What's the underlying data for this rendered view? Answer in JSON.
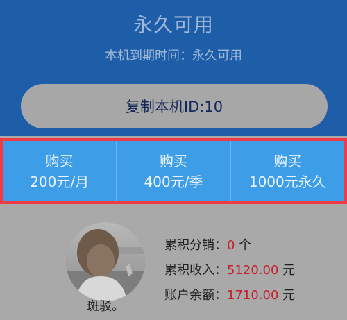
{
  "header": {
    "title": "永久可用",
    "expire_text": "本机到期时间：永久可用"
  },
  "copy_button": {
    "label": "复制本机ID:10"
  },
  "buy_options": [
    {
      "action": "购买",
      "price": "200元/月"
    },
    {
      "action": "购买",
      "price": "400元/季"
    },
    {
      "action": "购买",
      "price": "1000元永久"
    }
  ],
  "profile": {
    "username": "斑驳。"
  },
  "stats": [
    {
      "label": "累积分销：",
      "value": "0",
      "unit": " 个"
    },
    {
      "label": "累积收入：",
      "value": "5120.00",
      "unit": " 元"
    },
    {
      "label": "账户余额：",
      "value": "1710.00",
      "unit": " 元"
    }
  ],
  "colors": {
    "header_bg": "#1e5ea8",
    "body_bg": "#a9a9a9",
    "buy_bar_bg": "#3d9de7",
    "highlight_border": "#ef3b46",
    "value_red": "#c4212c"
  }
}
